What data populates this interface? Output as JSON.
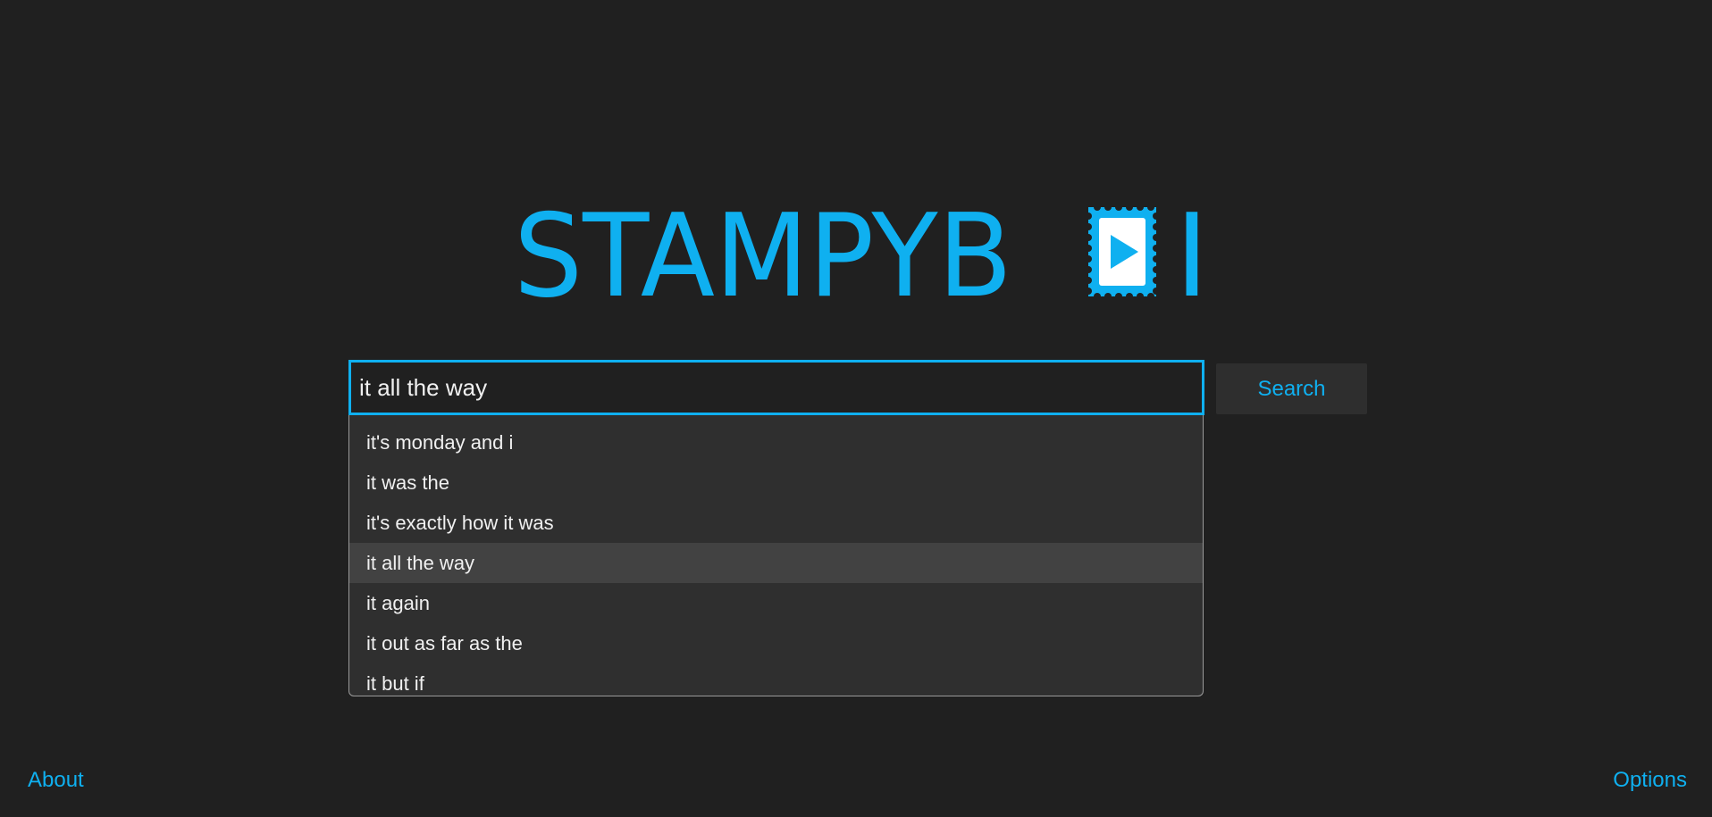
{
  "logo": {
    "text": "STAMPYB",
    "end_text": "I",
    "icon": "stamp-play-icon",
    "color": "#0fb0f0"
  },
  "search": {
    "value": "it all the way",
    "button_label": "Search",
    "border_color": "#0fb0f0"
  },
  "suggestions": [
    "it's monday and i",
    "it was the",
    "it's exactly how it was",
    "it all the way",
    "it again",
    "it out as far as the",
    "it but if"
  ],
  "selected_suggestion": "it all the way",
  "footer": {
    "about_label": "About",
    "options_label": "Options"
  },
  "colors": {
    "background": "#202020",
    "accent": "#0fb0f0",
    "dropdown_bg": "#2f2f2f",
    "highlight_bg": "#424242"
  }
}
